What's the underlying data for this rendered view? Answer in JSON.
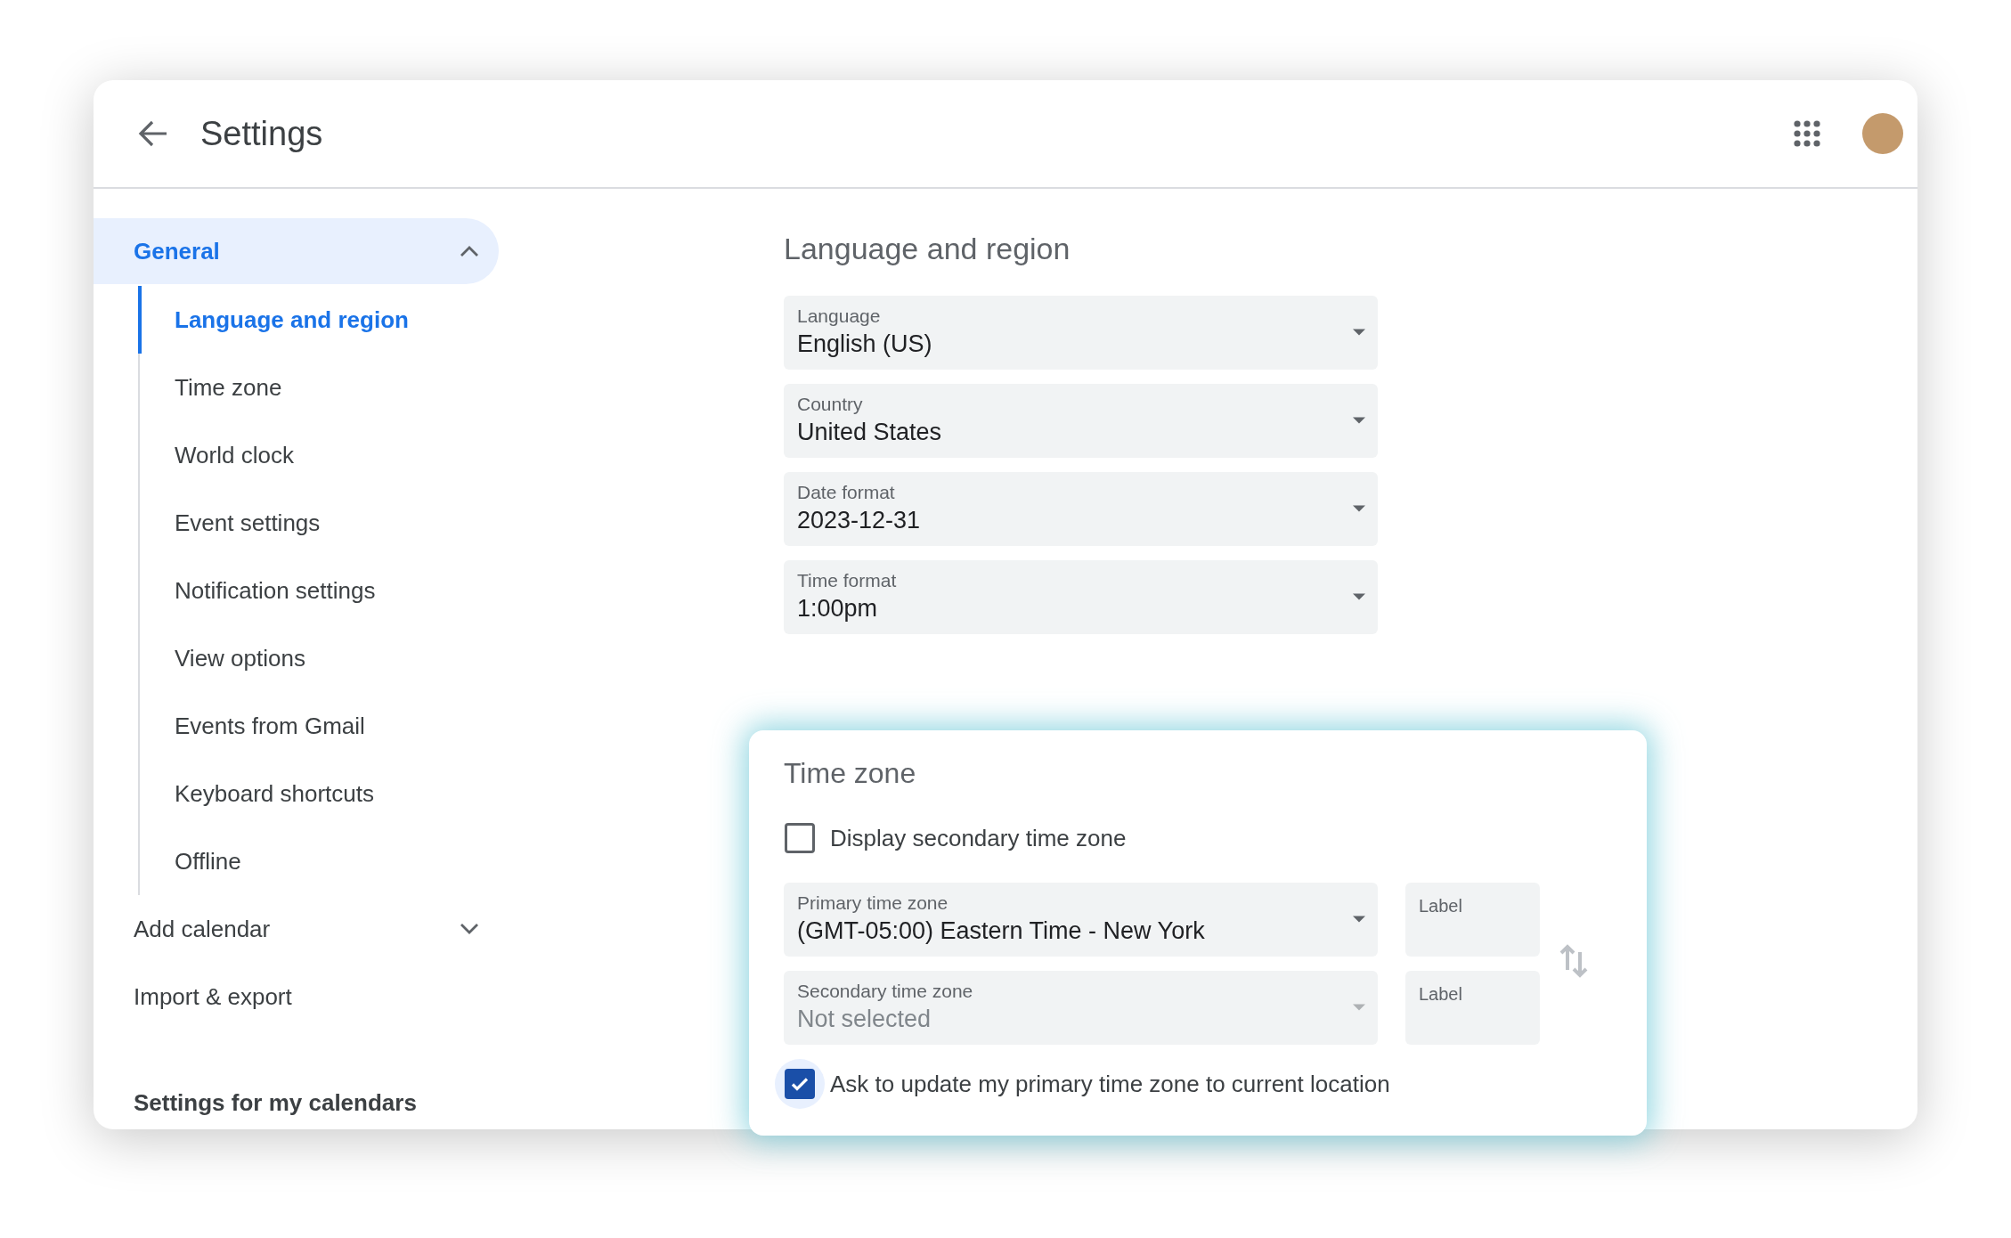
{
  "header": {
    "title": "Settings"
  },
  "sidebar": {
    "items": [
      {
        "label": "General",
        "selected": true,
        "expanded": true,
        "children": [
          {
            "label": "Language and region",
            "selected": true
          },
          {
            "label": "Time zone",
            "selected": false
          },
          {
            "label": "World clock",
            "selected": false
          },
          {
            "label": "Event settings",
            "selected": false
          },
          {
            "label": "Notification settings",
            "selected": false
          },
          {
            "label": "View options",
            "selected": false
          },
          {
            "label": "Events from Gmail",
            "selected": false
          },
          {
            "label": "Keyboard shortcuts",
            "selected": false
          },
          {
            "label": "Offline",
            "selected": false
          }
        ]
      },
      {
        "label": "Add calendar",
        "selected": false,
        "expanded": false
      },
      {
        "label": "Import & export",
        "selected": false
      }
    ],
    "heading": "Settings for my calendars"
  },
  "language_region": {
    "title": "Language and region",
    "fields": [
      {
        "label": "Language",
        "value": "English (US)"
      },
      {
        "label": "Country",
        "value": "United States"
      },
      {
        "label": "Date format",
        "value": "2023-12-31"
      },
      {
        "label": "Time format",
        "value": "1:00pm"
      }
    ]
  },
  "time_zone": {
    "title": "Time zone",
    "display_secondary": {
      "label": "Display secondary time zone",
      "checked": false
    },
    "zones": [
      {
        "label": "Primary time zone",
        "value": "(GMT-05:00) Eastern Time - New York",
        "disabled": false,
        "label_field": {
          "placeholder": "Label"
        }
      },
      {
        "label": "Secondary time zone",
        "value": "Not selected",
        "disabled": true,
        "label_field": {
          "placeholder": "Label"
        }
      }
    ],
    "ask_update": {
      "label": "Ask to update my primary time zone to current location",
      "checked": true,
      "focused": true
    }
  }
}
